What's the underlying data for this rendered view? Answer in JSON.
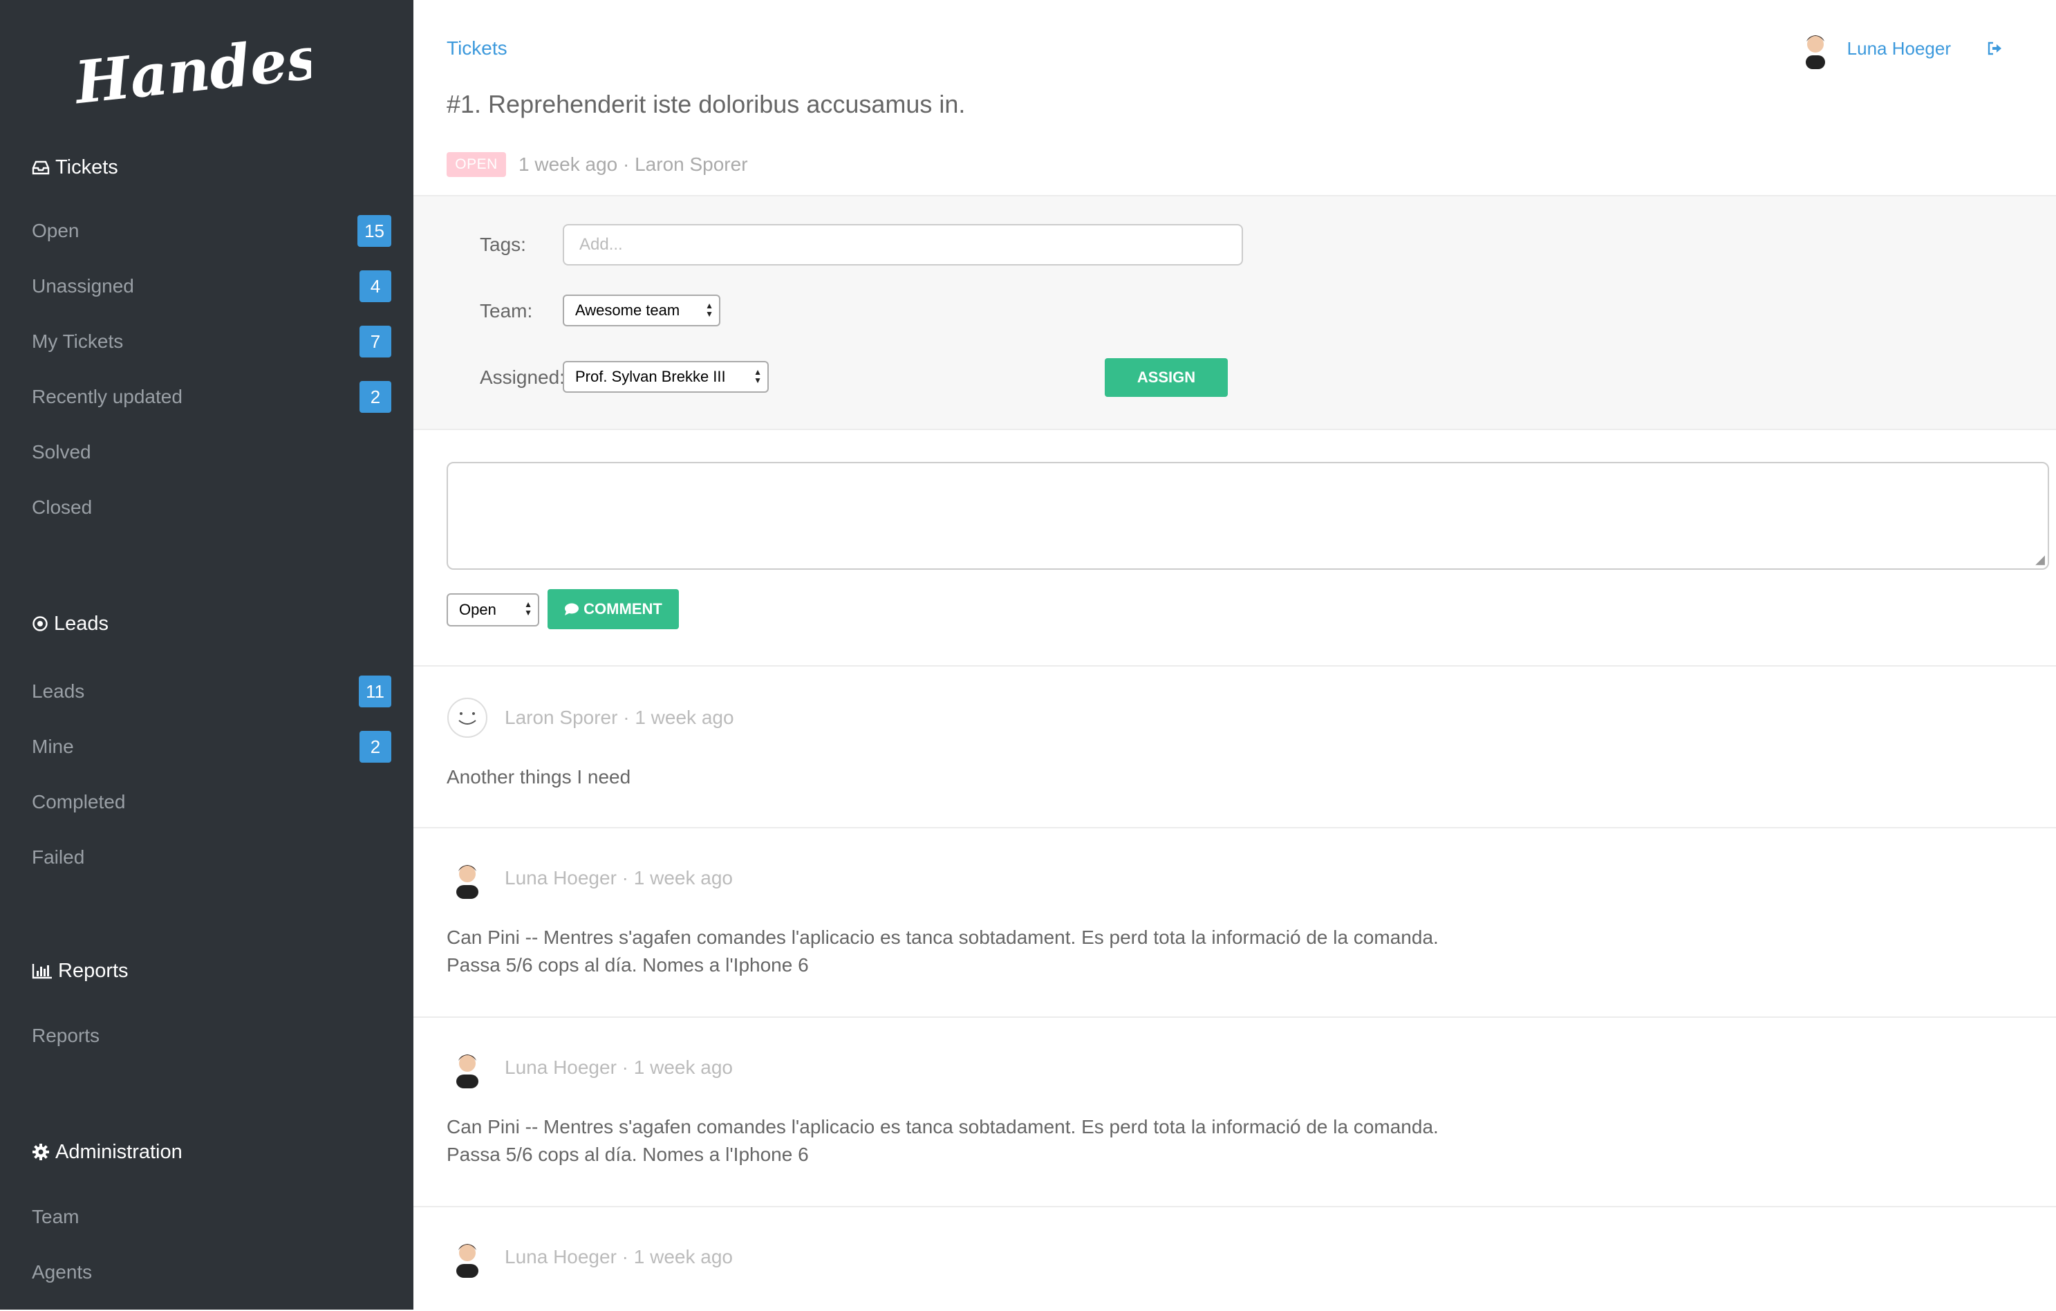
{
  "app": {
    "logo_text": "Handesk"
  },
  "sidebar": {
    "sections": [
      {
        "title": "Tickets",
        "icon": "inbox-icon",
        "items": [
          {
            "label": "Open",
            "count": "15"
          },
          {
            "label": "Unassigned",
            "count": "4"
          },
          {
            "label": "My Tickets",
            "count": "7"
          },
          {
            "label": "Recently updated",
            "count": "2"
          },
          {
            "label": "Solved"
          },
          {
            "label": "Closed"
          }
        ]
      },
      {
        "title": "Leads",
        "icon": "target-icon",
        "items": [
          {
            "label": "Leads",
            "count": "11"
          },
          {
            "label": "Mine",
            "count": "2"
          },
          {
            "label": "Completed"
          },
          {
            "label": "Failed"
          }
        ]
      },
      {
        "title": "Reports",
        "icon": "bar-chart-icon",
        "items": [
          {
            "label": "Reports"
          }
        ]
      },
      {
        "title": "Administration",
        "icon": "gear-icon",
        "items": [
          {
            "label": "Team"
          },
          {
            "label": "Agents"
          }
        ]
      }
    ]
  },
  "header": {
    "breadcrumb": "Tickets",
    "user_name": "Luna Hoeger",
    "logout_icon": "sign-out-icon"
  },
  "ticket": {
    "title": "#1. Reprehenderit iste doloribus accusamus in.",
    "status": "OPEN",
    "meta": "1 week ago · Laron Sporer"
  },
  "form": {
    "tags_label": "Tags:",
    "tags_placeholder": "Add...",
    "team_label": "Team:",
    "team_value": "Awesome team",
    "assigned_label": "Assigned:",
    "assigned_value": "Prof. Sylvan Brekke III",
    "assign_button": "ASSIGN"
  },
  "compose": {
    "status_value": "Open",
    "comment_button": "COMMENT"
  },
  "comments": [
    {
      "author": "Laron Sporer · 1 week ago",
      "avatar": "smiley-avatar",
      "lines": [
        "Another things I need"
      ]
    },
    {
      "author": "Luna Hoeger · 1 week ago",
      "avatar": "user-avatar",
      "lines": [
        "Can Pini -- Mentres s'agafen comandes l'aplicacio es tanca sobtadament. Es perd tota la informació de la comanda.",
        "Passa 5/6 cops al día. Nomes a l'Iphone 6"
      ]
    },
    {
      "author": "Luna Hoeger · 1 week ago",
      "avatar": "user-avatar",
      "lines": [
        "Can Pini -- Mentres s'agafen comandes l'aplicacio es tanca sobtadament. Es perd tota la informació de la comanda.",
        "Passa 5/6 cops al día. Nomes a l'Iphone 6"
      ]
    },
    {
      "author": "Luna Hoeger · 1 week ago",
      "avatar": "user-avatar",
      "lines": []
    }
  ],
  "colors": {
    "sidebar_bg": "#2e3338",
    "accent_blue": "#3c99dc",
    "accent_green": "#35be8b",
    "status_open": "#ffccd6"
  }
}
